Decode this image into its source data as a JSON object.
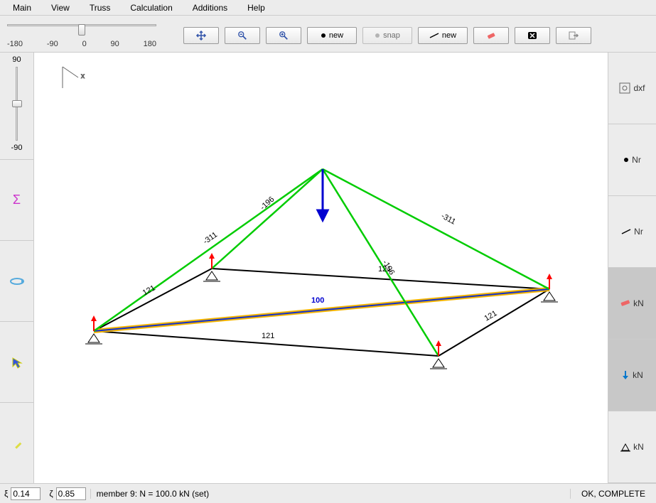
{
  "menu": {
    "main": "Main",
    "view": "View",
    "truss": "Truss",
    "calculation": "Calculation",
    "additions": "Additions",
    "help": "Help"
  },
  "hslider": {
    "labels": [
      "-180",
      "-90",
      "0",
      "90",
      "180"
    ]
  },
  "vslider": {
    "top": "90",
    "bottom": "-90"
  },
  "toolbar": {
    "new1": "new",
    "snap": "snap",
    "new2": "new"
  },
  "right": {
    "dxf": "dxf",
    "nr1": "Nr",
    "nr2": "Nr",
    "kn1": "kN",
    "kn2": "kN",
    "kn3": "kN"
  },
  "status": {
    "xi_label": "ξ",
    "xi": "0.14",
    "zeta_label": "ζ",
    "zeta": "0.85",
    "message": "member 9: N = 100.0 kN (set)",
    "ok": "OK, COMPLETE"
  },
  "axes": {
    "x": "x"
  },
  "truss_labels": {
    "m1": "121",
    "m2": "121",
    "m3": "121",
    "m4": "121",
    "m5": "-311",
    "m6": "-196",
    "m7": "-311",
    "m8": "-196",
    "m9": "100"
  }
}
